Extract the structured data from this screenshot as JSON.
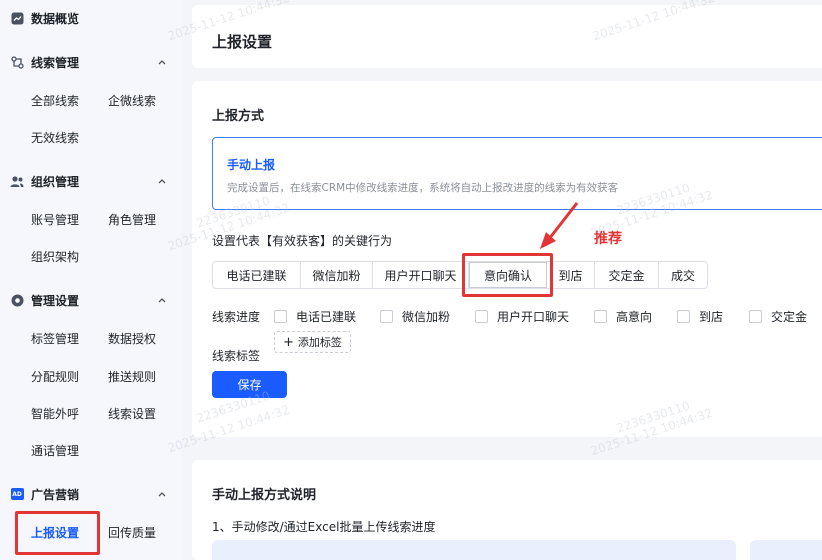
{
  "sidebar": {
    "sections": [
      {
        "label": "数据概览",
        "icon": "chart-icon"
      },
      {
        "label": "线索管理",
        "icon": "flow-icon",
        "items": [
          "全部线索",
          "企微线索",
          "无效线索"
        ]
      },
      {
        "label": "组织管理",
        "icon": "users-icon",
        "items": [
          "账号管理",
          "角色管理",
          "组织架构"
        ]
      },
      {
        "label": "管理设置",
        "icon": "settings-icon",
        "items": [
          "标签管理",
          "数据授权",
          "分配规则",
          "推送规则",
          "智能外呼",
          "线索设置",
          "通话管理"
        ]
      },
      {
        "label": "广告营销",
        "icon": "ad-icon",
        "badge": "AD",
        "items": [
          "上报设置",
          "回传质量"
        ]
      }
    ]
  },
  "header": {
    "title": "上报设置"
  },
  "report": {
    "section_title": "上报方式",
    "method_name": "手动上报",
    "method_desc": "完成设置后，在线索CRM中修改线索进度，系统将自动上报改进度的线索为有效获客",
    "key_label": "设置代表【有效获客】的关键行为",
    "behaviors": [
      "电话已建联",
      "微信加粉",
      "用户开口聊天",
      "意向确认",
      "到店",
      "交定金",
      "成交"
    ],
    "selected_behavior": "意向确认",
    "recommend_label": "推荐",
    "progress_label": "线索进度",
    "progress_options": [
      "电话已建联",
      "微信加粉",
      "用户开口聊天",
      "高意向",
      "到店",
      "交定金"
    ],
    "tag_label": "线索标签",
    "add_tag": "添加标签",
    "save": "保存"
  },
  "manual": {
    "title": "手动上报方式说明",
    "step1": "1、手动修改/通过Excel批量上传线索进度"
  },
  "watermark": {
    "id": "2236330110",
    "time": "2025-11-12 10:44:32"
  },
  "colors": {
    "accent": "#1a5cff",
    "annotation": "#e23636"
  }
}
